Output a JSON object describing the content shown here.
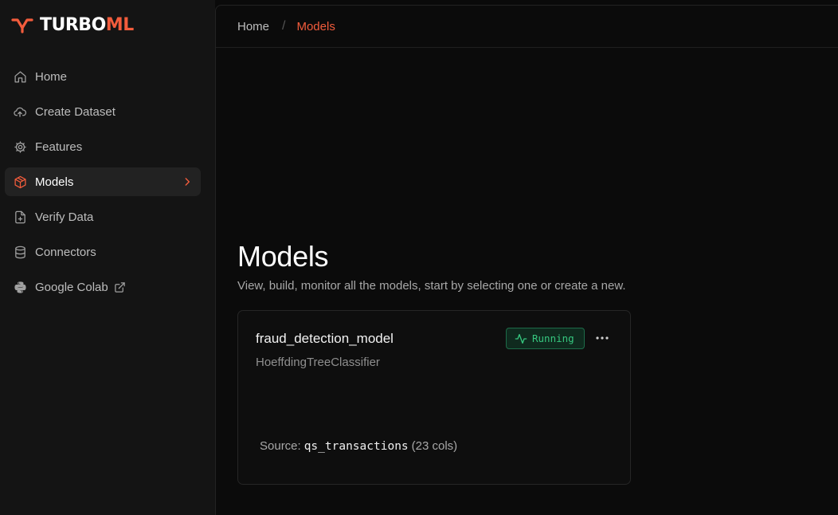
{
  "app": {
    "logo_primary": "TURBO",
    "logo_accent": "ML"
  },
  "colors": {
    "accent": "#f25c3c",
    "running_green": "#36c77f"
  },
  "sidebar": {
    "items": [
      {
        "label": "Home",
        "icon": "home-icon"
      },
      {
        "label": "Create Dataset",
        "icon": "cloud-upload-icon"
      },
      {
        "label": "Features",
        "icon": "gear-icon"
      },
      {
        "label": "Models",
        "icon": "cube-icon",
        "active": true
      },
      {
        "label": "Verify Data",
        "icon": "file-plus-icon"
      },
      {
        "label": "Connectors",
        "icon": "database-icon"
      },
      {
        "label": "Google Colab",
        "icon": "python-icon",
        "external": true
      }
    ]
  },
  "breadcrumb": {
    "home": "Home",
    "separator": "/",
    "current": "Models"
  },
  "page": {
    "title": "Models",
    "subtitle": "View, build, monitor all the models, start by selecting one or create a new."
  },
  "model_card": {
    "name": "fraud_detection_model",
    "type": "HoeffdingTreeClassifier",
    "status": "Running",
    "source_label": "Source:",
    "source_name": "qs_transactions",
    "source_cols": "(23 cols)"
  }
}
